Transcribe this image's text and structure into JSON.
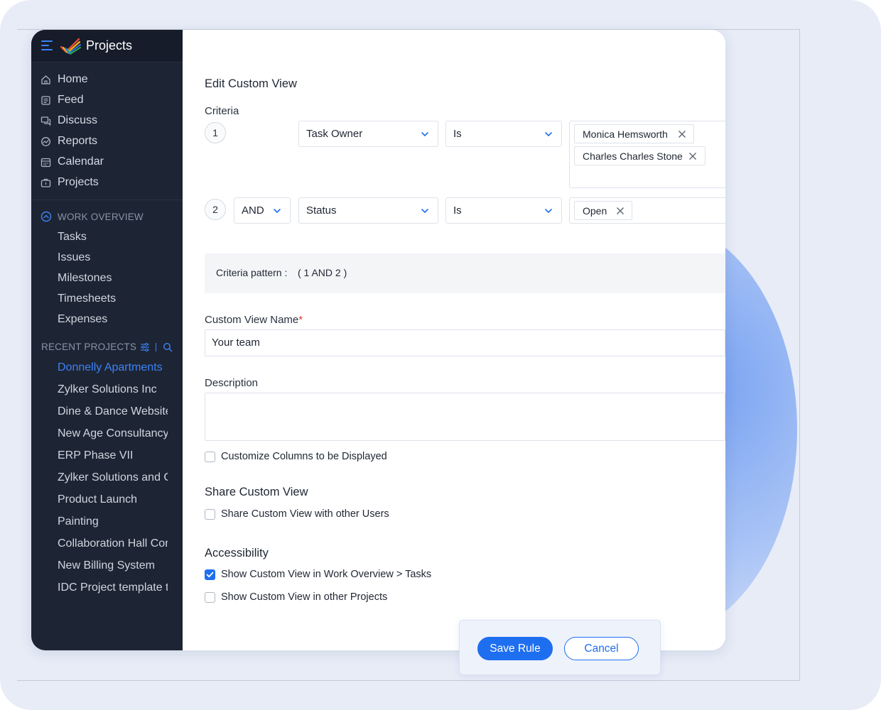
{
  "app": {
    "title": "Projects"
  },
  "nav": [
    {
      "label": "Home",
      "icon": "home-icon"
    },
    {
      "label": "Feed",
      "icon": "feed-icon"
    },
    {
      "label": "Discuss",
      "icon": "discuss-icon"
    },
    {
      "label": "Reports",
      "icon": "reports-icon"
    },
    {
      "label": "Calendar",
      "icon": "calendar-icon"
    },
    {
      "label": "Projects",
      "icon": "briefcase-icon"
    }
  ],
  "work_overview": {
    "label": "WORK OVERVIEW",
    "items": [
      "Tasks",
      "Issues",
      "Milestones",
      "Timesheets",
      "Expenses"
    ]
  },
  "recent_projects": {
    "label": "RECENT PROJECTS",
    "items": [
      "Donnelly Apartments",
      "Zylker Solutions Inc",
      "Dine & Dance Website",
      "New Age Consultancy",
      "ERP Phase VII",
      "Zylker Solutions and Co",
      "Product Launch",
      "Painting",
      "Collaboration Hall Construction",
      "New Billing System",
      "IDC Project template test"
    ]
  },
  "form": {
    "title": "Edit Custom View",
    "criteria_label": "Criteria",
    "criteria": [
      {
        "number": "1",
        "field": "Task Owner",
        "operator": "Is",
        "values": [
          "Monica Hemsworth",
          "Charles Charles Stone"
        ]
      },
      {
        "number": "2",
        "conjunction": "AND",
        "field": "Status",
        "operator": "Is",
        "values": [
          "Open"
        ]
      }
    ],
    "pattern_label": "Criteria pattern :",
    "pattern_value": "( 1 AND 2 )",
    "name_label": "Custom View Name",
    "name_required": "*",
    "name_value": "Your team",
    "description_label": "Description",
    "description_value": "",
    "customize_columns": {
      "label": "Customize Columns to be Displayed",
      "checked": false
    },
    "share_heading": "Share Custom View",
    "share_option": {
      "label": "Share Custom View with other Users",
      "checked": false
    },
    "accessibility_heading": "Accessibility",
    "accessibility_options": [
      {
        "label": "Show Custom View in Work Overview > Tasks",
        "checked": true
      },
      {
        "label": "Show Custom View in other Projects",
        "checked": false
      }
    ]
  },
  "actions": {
    "save_label": "Save Rule",
    "cancel_label": "Cancel"
  },
  "colors": {
    "accent": "#1e6ef0",
    "sidebar_bg": "#1d2433",
    "active_link": "#3d83f5"
  }
}
